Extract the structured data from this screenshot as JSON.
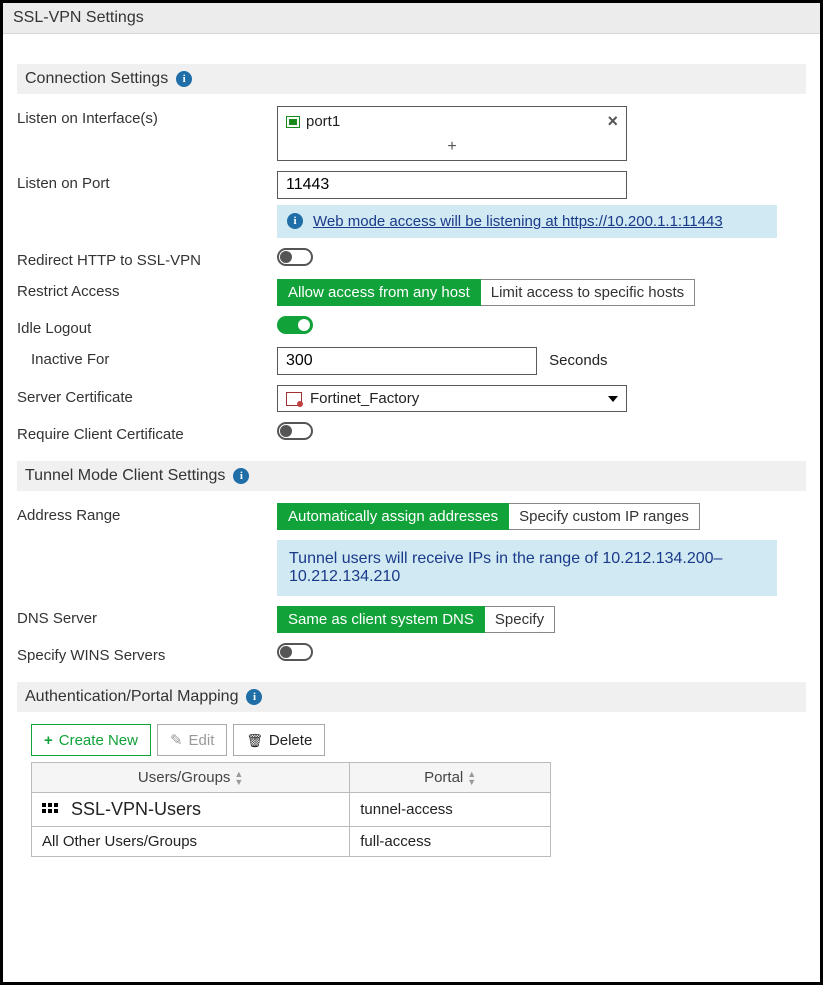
{
  "title": "SSL-VPN Settings",
  "connection": {
    "header": "Connection Settings",
    "listen_interfaces_label": "Listen on Interface(s)",
    "interfaces": {
      "item0": "port1",
      "add": "+"
    },
    "listen_port_label": "Listen on Port",
    "listen_port_value": "11443",
    "web_mode_msg_prefix": "Web mode access will be listening at ",
    "web_mode_link": "https://10.200.1.1:11443",
    "redirect_label": "Redirect HTTP to SSL-VPN",
    "restrict_label": "Restrict Access",
    "restrict_opt_any": "Allow access from any host",
    "restrict_opt_specific": "Limit access to specific hosts",
    "idle_logout_label": "Idle Logout",
    "inactive_for_label": "Inactive For",
    "inactive_for_value": "300",
    "inactive_suffix": "Seconds",
    "server_cert_label": "Server Certificate",
    "server_cert_value": "Fortinet_Factory",
    "require_client_cert_label": "Require Client Certificate"
  },
  "tunnel": {
    "header": "Tunnel Mode Client Settings",
    "address_range_label": "Address Range",
    "range_opt_auto": "Automatically assign addresses",
    "range_opt_custom": "Specify custom IP ranges",
    "range_info": "Tunnel users will receive IPs in the range of 10.212.134.200–10.212.134.210",
    "dns_label": "DNS Server",
    "dns_opt_same": "Same as client system DNS",
    "dns_opt_specify": "Specify",
    "wins_label": "Specify WINS Servers"
  },
  "auth": {
    "header": "Authentication/Portal Mapping",
    "btn_create": "Create New",
    "btn_edit": "Edit",
    "btn_delete": "Delete",
    "col_users": "Users/Groups",
    "col_portal": "Portal",
    "rows": {
      "r0": {
        "user": "SSL-VPN-Users",
        "portal": "tunnel-access"
      },
      "r1": {
        "user": "All Other Users/Groups",
        "portal": "full-access"
      }
    }
  }
}
